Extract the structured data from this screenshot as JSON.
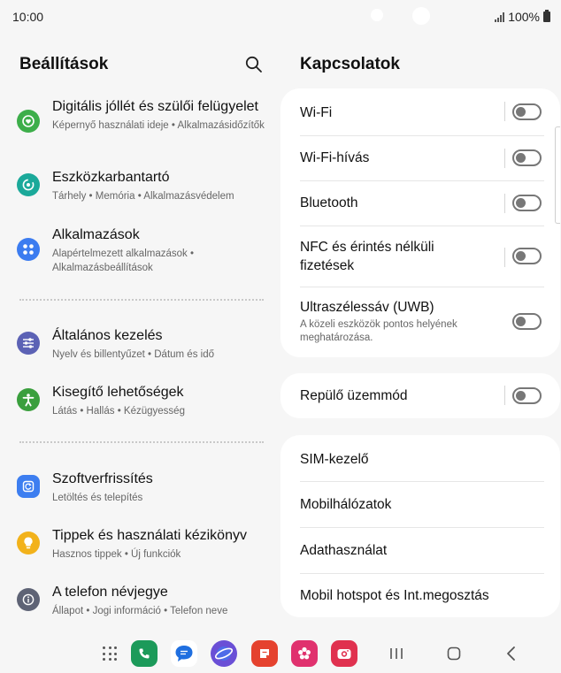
{
  "status_bar": {
    "time": "10:00",
    "battery": "100%"
  },
  "left_pane": {
    "title": "Beállítások",
    "search_icon": "search-icon",
    "items": [
      {
        "title": "Digitális jóllét és szülői felügyelet",
        "subtitle": "Képernyő használati ideje  •  Alkalmazásidőzítők",
        "icon": "heart-icon",
        "color": "#3dae4a"
      },
      {
        "title": "Eszközkarbantartó",
        "subtitle": "Tárhely  •  Memória  •  Alkalmazásvédelem",
        "icon": "device-care-icon",
        "color": "#1ba99a"
      },
      {
        "title": "Alkalmazások",
        "subtitle": "Alapértelmezett alkalmazások  •  Alkalmazásbeállítások",
        "icon": "apps-icon",
        "color": "#3c7cf0"
      },
      {
        "title": "Általános kezelés",
        "subtitle": "Nyelv és billentyűzet  •  Dátum és idő",
        "icon": "sliders-icon",
        "color": "#5c62b5"
      },
      {
        "title": "Kisegítő lehetőségek",
        "subtitle": "Látás  •  Hallás  •  Kézügyesség",
        "icon": "accessibility-icon",
        "color": "#3a9f3d"
      },
      {
        "title": "Szoftverfrissítés",
        "subtitle": "Letöltés és telepítés",
        "icon": "update-icon",
        "color": "#3d7ef0"
      },
      {
        "title": "Tippek és használati kézikönyv",
        "subtitle": "Hasznos tippek  •  Új funkciók",
        "icon": "bulb-icon",
        "color": "#f2b21b"
      },
      {
        "title": "A telefon névjegye",
        "subtitle": "Állapot  •  Jogi információ  •  Telefon neve",
        "icon": "info-icon",
        "color": "#5e6375"
      }
    ]
  },
  "right_pane": {
    "title": "Kapcsolatok",
    "group1": [
      {
        "label": "Wi-Fi",
        "toggle": "off"
      },
      {
        "label": "Wi-Fi-hívás",
        "toggle": "off"
      },
      {
        "label": "Bluetooth",
        "toggle": "off"
      },
      {
        "label": "NFC és érintés nélküli fizetések",
        "toggle": "off"
      },
      {
        "label": "Ultraszélessáv (UWB)",
        "subtitle": "A közeli eszközök pontos helyének meghatározása.",
        "toggle": "off"
      }
    ],
    "group2": [
      {
        "label": "Repülő üzemmód",
        "toggle": "off"
      }
    ],
    "group3": [
      {
        "label": "SIM-kezelő"
      },
      {
        "label": "Mobilhálózatok"
      },
      {
        "label": "Adathasználat"
      },
      {
        "label": "Mobil hotspot és Int.megosztás"
      }
    ]
  },
  "dock": {
    "apps": [
      {
        "icon": "apps-drawer-icon"
      },
      {
        "icon": "phone-icon",
        "color": "#1c9a5a"
      },
      {
        "icon": "messages-icon",
        "color": "#1f6fe0"
      },
      {
        "icon": "internet-icon",
        "color": "#6a4fd6"
      },
      {
        "icon": "notes-icon",
        "color": "#e5422e"
      },
      {
        "icon": "gallery-icon",
        "color": "#e0316e"
      },
      {
        "icon": "camera-icon",
        "color": "#e0314f"
      }
    ],
    "nav": [
      "recents-icon",
      "home-icon",
      "back-icon"
    ]
  }
}
